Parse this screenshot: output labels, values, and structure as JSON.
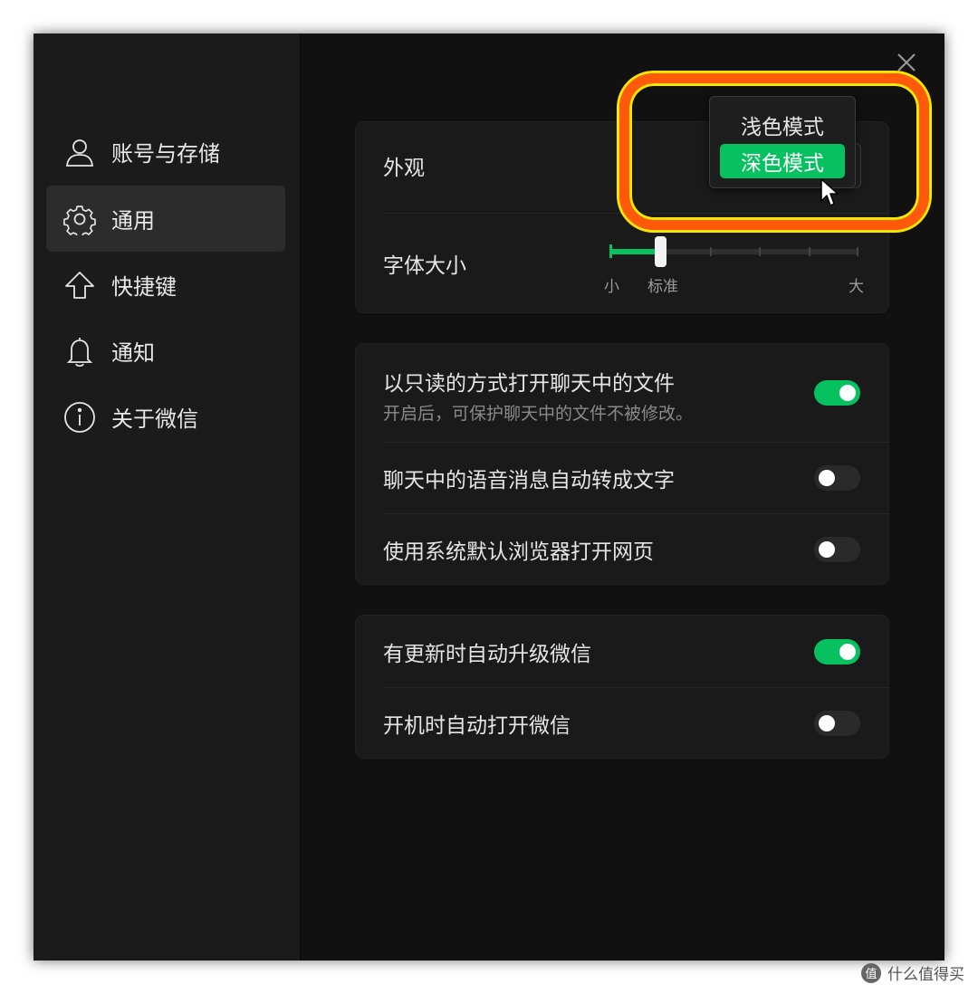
{
  "sidebar": {
    "items": [
      {
        "label": "账号与存储",
        "icon": "user-icon"
      },
      {
        "label": "通用",
        "icon": "gear-icon",
        "active": true
      },
      {
        "label": "快捷键",
        "icon": "arrow-up-icon"
      },
      {
        "label": "通知",
        "icon": "bell-icon"
      },
      {
        "label": "关于微信",
        "icon": "info-icon"
      }
    ]
  },
  "appearance": {
    "label": "外观",
    "options": [
      "浅色模式",
      "深色模式"
    ],
    "selected": "深色模式"
  },
  "font_size": {
    "label": "字体大小",
    "marks": {
      "small": "小",
      "standard": "标准",
      "large": "大"
    },
    "level": "标准",
    "steps": 6,
    "value_index": 1
  },
  "chat_settings": [
    {
      "label": "以只读的方式打开聊天中的文件",
      "sub": "开启后，可保护聊天中的文件不被修改。",
      "on": true
    },
    {
      "label": "聊天中的语音消息自动转成文字",
      "on": false
    },
    {
      "label": "使用系统默认浏览器打开网页",
      "on": false
    }
  ],
  "update_settings": [
    {
      "label": "有更新时自动升级微信",
      "on": true
    },
    {
      "label": "开机时自动打开微信",
      "on": false
    }
  ],
  "watermark": {
    "text": "什么值得买",
    "logo": "值"
  },
  "colors": {
    "accent": "#07c160",
    "highlight": "#ff5a0a",
    "highlight_edge": "#ffe600",
    "background": "#111111",
    "sidebar": "#1b1b1b"
  }
}
